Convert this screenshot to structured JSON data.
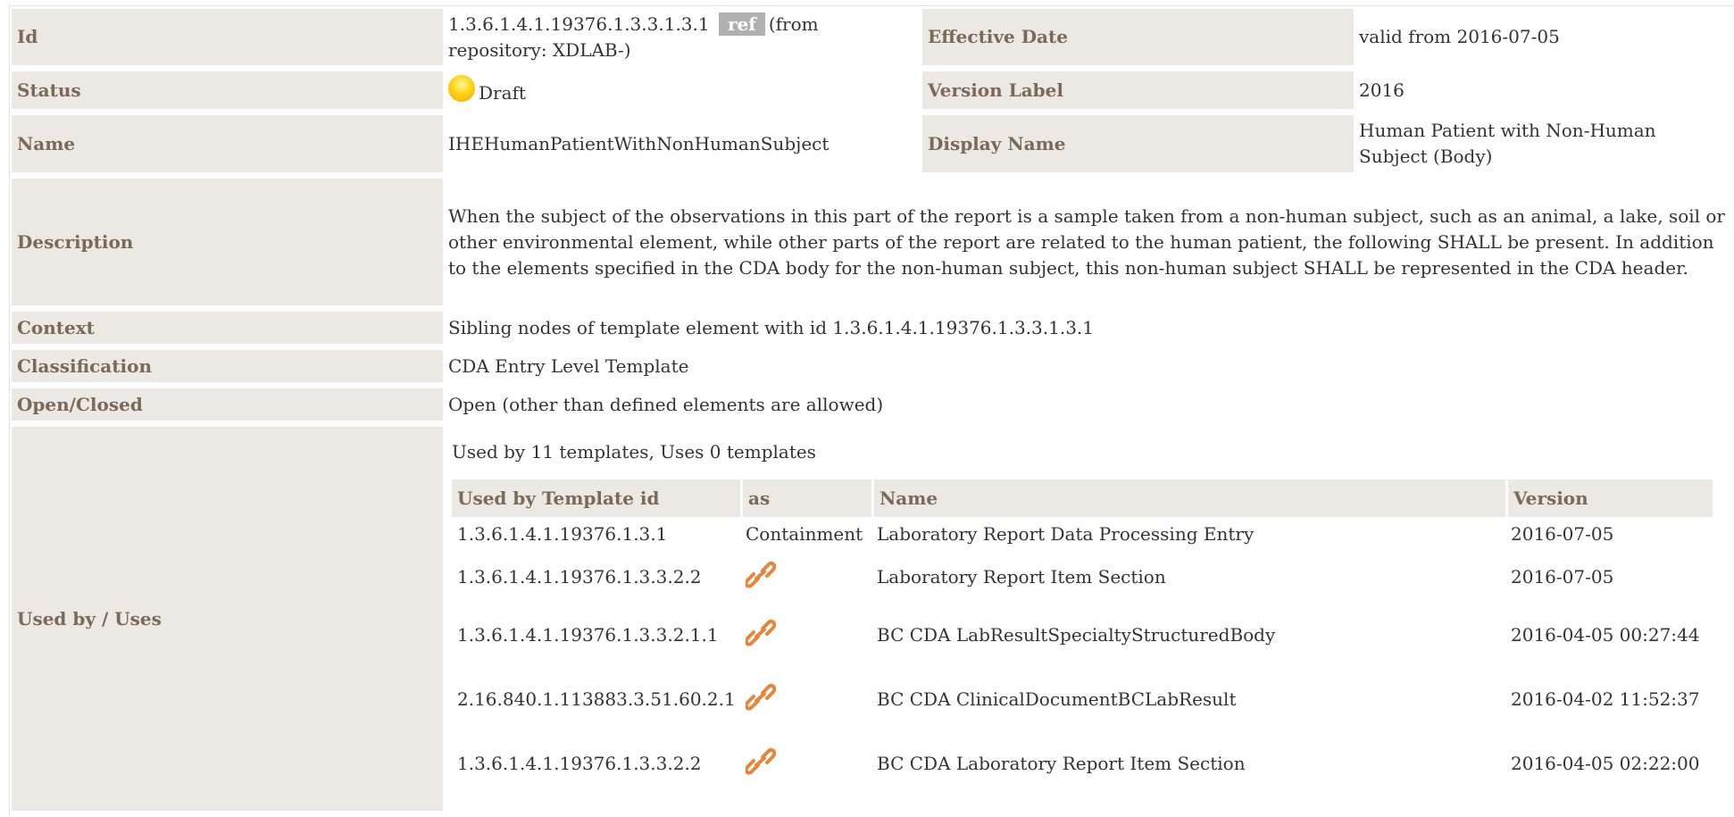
{
  "rows": {
    "id": {
      "label": "Id",
      "value": "1.3.6.1.4.1.19376.1.3.3.1.3.1",
      "badge": "ref",
      "suffix": "(from repository: XDLAB-)"
    },
    "effective_date": {
      "label": "Effective Date",
      "value": "valid from 2016-07-05"
    },
    "status": {
      "label": "Status",
      "value": "Draft",
      "icon": "draft-status-icon",
      "icon_color": "#ffd81a"
    },
    "version_label": {
      "label": "Version Label",
      "value": "2016"
    },
    "name": {
      "label": "Name",
      "value": "IHEHumanPatientWithNonHumanSubject"
    },
    "display_name": {
      "label": "Display Name",
      "value": "Human Patient with Non-Human Subject (Body)"
    },
    "description": {
      "label": "Description",
      "value": "When the subject of the observations in this part of the report is a sample taken from a non-human subject, such as an animal, a lake, soil or other environmental element, while other parts of the report are related to the human patient, the following SHALL be present. In addition to the elements specified in the CDA body for the non-human subject, this non-human subject SHALL be represented in the CDA header."
    },
    "context": {
      "label": "Context",
      "value": "Sibling nodes of template element with id 1.3.6.1.4.1.19376.1.3.3.1.3.1"
    },
    "classification": {
      "label": "Classification",
      "value": "CDA Entry Level Template"
    },
    "open_closed": {
      "label": "Open/Closed",
      "value": "Open (other than defined elements are allowed)"
    },
    "used_by": {
      "label": "Used by / Uses",
      "summary": "Used by 11 templates, Uses 0 templates"
    }
  },
  "used_by_table": {
    "headers": {
      "template_id": "Used by Template id",
      "as": "as",
      "name": "Name",
      "version": "Version"
    },
    "rows": [
      {
        "template_id": "1.3.6.1.4.1.19376.1.3.1",
        "as": "Containment",
        "name": "Laboratory Report Data Processing Entry",
        "version": "2016-07-05"
      },
      {
        "template_id": "1.3.6.1.4.1.19376.1.3.3.2.2",
        "as": "link-icon",
        "name": "Laboratory Report Item Section",
        "version": "2016-07-05"
      },
      {
        "template_id": "1.3.6.1.4.1.19376.1.3.3.2.1.1",
        "as": "link-icon",
        "name": "BC CDA LabResultSpecialtyStructuredBody",
        "version": "2016-04-05 00:27:44"
      },
      {
        "template_id": "2.16.840.1.113883.3.51.60.2.1",
        "as": "link-icon",
        "name": "BC CDA ClinicalDocumentBCLabResult",
        "version": "2016-04-02 11:52:37"
      },
      {
        "template_id": "1.3.6.1.4.1.19376.1.3.3.2.2",
        "as": "link-icon",
        "name": "BC CDA Laboratory Report Item Section",
        "version": "2016-04-05 02:22:00"
      }
    ]
  },
  "colors": {
    "label_bg": "#ece8e3",
    "label_text": "#7a6a58",
    "link_icon": "#e8853a",
    "badge_bg": "#b0b0b0"
  }
}
